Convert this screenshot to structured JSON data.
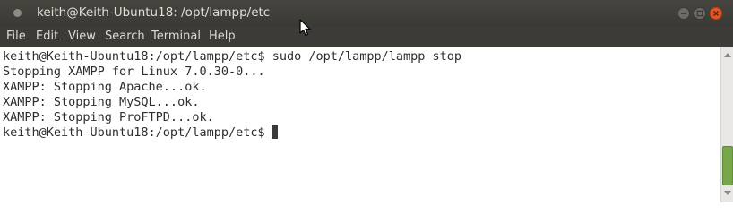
{
  "window": {
    "title": "keith@Keith-Ubuntu18: /opt/lampp/etc",
    "icons": [
      "app-dot-icon",
      "minimize-icon",
      "maximize-icon",
      "close-icon"
    ],
    "accent_close": "#e95420"
  },
  "menu": {
    "items": [
      "File",
      "Edit",
      "View",
      "Search",
      "Terminal",
      "Help"
    ]
  },
  "terminal": {
    "lines": [
      "keith@Keith-Ubuntu18:/opt/lampp/etc$ sudo /opt/lampp/lampp stop",
      "Stopping XAMPP for Linux 7.0.30-0...",
      "XAMPP: Stopping Apache...ok.",
      "XAMPP: Stopping MySQL...ok.",
      "XAMPP: Stopping ProFTPD...ok."
    ],
    "prompt": "keith@Keith-Ubuntu18:/opt/lampp/etc$"
  },
  "colors": {
    "titlebar": "#3c3b37",
    "terminal_bg": "#ffffff",
    "terminal_fg": "#2e2e2e",
    "scroll_thumb": "#77a64b"
  }
}
